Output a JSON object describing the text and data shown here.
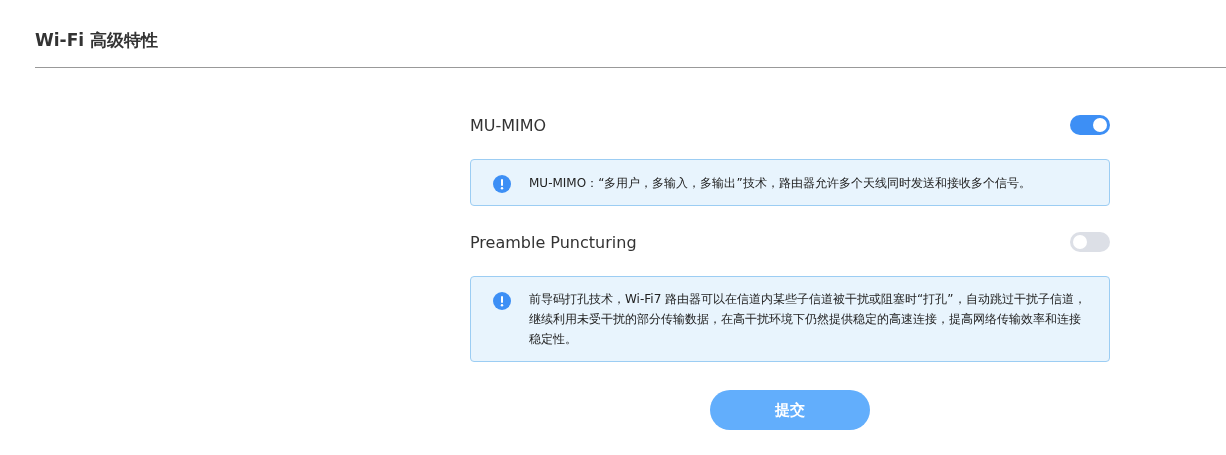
{
  "title": "Wi-Fi 高级特性",
  "features": [
    {
      "label": "MU-MIMO",
      "on": true,
      "info": "MU-MIMO：“多用户，多输入，多输出”技术，路由器允许多个天线同时发送和接收多个信号。"
    },
    {
      "label": "Preamble Puncturing",
      "on": false,
      "info": "前导码打孔技术，Wi-Fi7 路由器可以在信道内某些子信道被干扰或阻塞时“打孔”，自动跳过干扰子信道，继续利用未受干扰的部分传输数据，在高干扰环境下仍然提供稳定的高速连接，提高网络传输效率和连接稳定性。"
    }
  ],
  "submit": "提交"
}
